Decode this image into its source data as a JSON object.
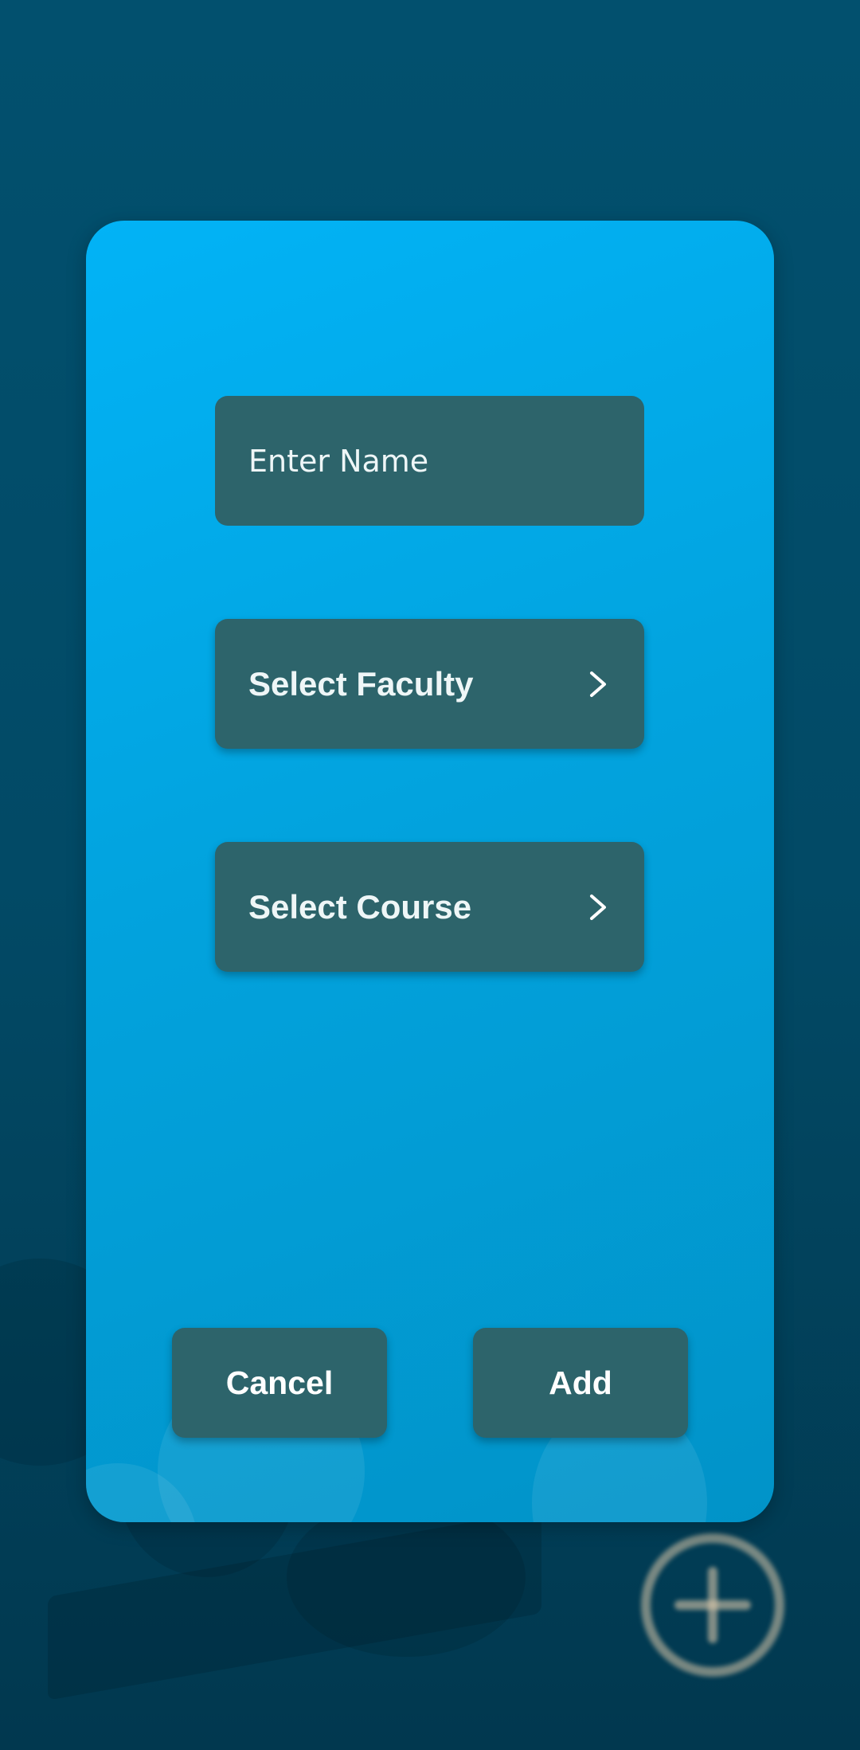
{
  "form": {
    "name_placeholder": "Enter Name",
    "faculty_label": "Select Faculty",
    "course_label": "Select Course"
  },
  "actions": {
    "cancel_label": "Cancel",
    "add_label": "Add"
  },
  "icons": {
    "field_chevron": "chevron-right-icon",
    "fab": "plus-circle-icon"
  },
  "colors": {
    "dialog_top": "#02b3f6",
    "dialog_bottom": "#0193c8",
    "field_bg": "#2d646b",
    "page_bg": "#024a66"
  }
}
